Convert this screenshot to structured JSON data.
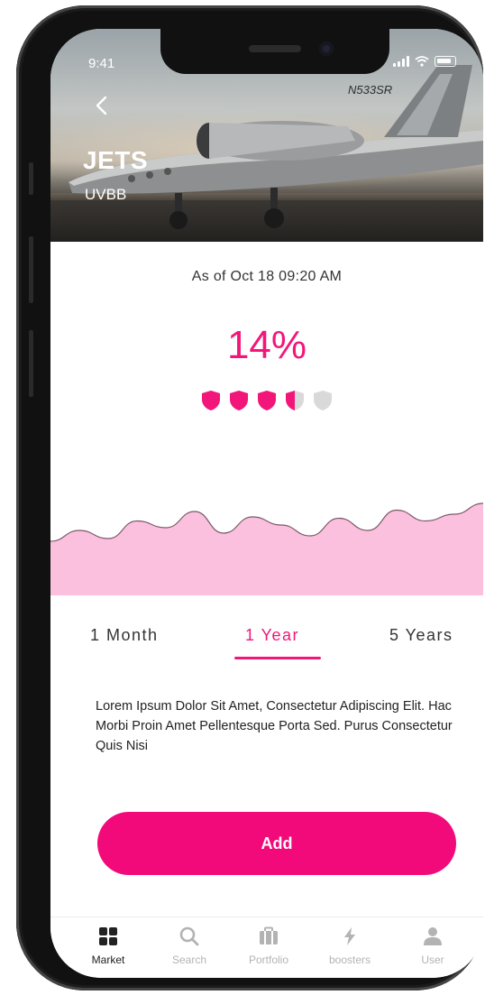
{
  "status_bar": {
    "time": "9:41"
  },
  "asset": {
    "name": "JETS",
    "code": "UVBB",
    "tail_number": "N533SR"
  },
  "as_of": "As of Oct 18 09:20 AM",
  "rating": {
    "percent_label": "14%",
    "shields_total": 5,
    "shields_filled": 3.5
  },
  "chart_data": {
    "type": "area",
    "values": [
      40,
      48,
      42,
      55,
      50,
      62,
      46,
      58,
      52,
      44,
      57,
      48,
      63,
      55,
      60,
      68
    ],
    "ylim": [
      0,
      100
    ],
    "fill_color": "#fbc0dd",
    "line_color": "#7a5a6a"
  },
  "range_tabs": [
    {
      "label": "1 Month",
      "active": false
    },
    {
      "label": "1 Year",
      "active": true
    },
    {
      "label": "5 Years",
      "active": false
    }
  ],
  "description": "Lorem Ipsum Dolor Sit Amet, Consectetur Adipiscing Elit. Hac Morbi Proin Amet Pellentesque Porta Sed. Purus Consectetur Quis Nisi",
  "add_button": {
    "label": "Add"
  },
  "nav": [
    {
      "label": "Market",
      "icon": "grid-icon",
      "active": true
    },
    {
      "label": "Search",
      "icon": "search-icon",
      "active": false
    },
    {
      "label": "Portfolio",
      "icon": "briefcase-icon",
      "active": false
    },
    {
      "label": "boosters",
      "icon": "bolt-icon",
      "active": false
    },
    {
      "label": "User",
      "icon": "user-icon",
      "active": false
    }
  ],
  "colors": {
    "accent": "#f3167a",
    "button": "#f20a7b",
    "inactive": "#b3b3b3"
  }
}
